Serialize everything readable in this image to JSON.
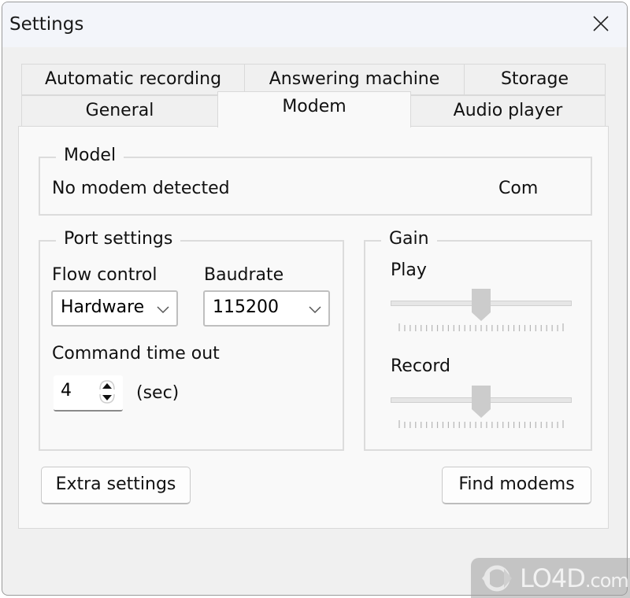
{
  "window": {
    "title": "Settings",
    "close_icon": "close-icon"
  },
  "tabs": {
    "row1": [
      {
        "label": "Automatic recording",
        "active": false
      },
      {
        "label": "Answering machine",
        "active": false
      },
      {
        "label": "Storage",
        "active": false
      }
    ],
    "row2": [
      {
        "label": "General",
        "active": false
      },
      {
        "label": "Modem",
        "active": true
      },
      {
        "label": "Audio player",
        "active": false
      }
    ]
  },
  "model_group": {
    "legend": "Model",
    "status": "No modem detected",
    "port": "Com"
  },
  "port_group": {
    "legend": "Port settings",
    "flow_control": {
      "label": "Flow control",
      "value": "Hardware"
    },
    "baudrate": {
      "label": "Baudrate",
      "value": "115200"
    },
    "command_timeout": {
      "label": "Command time out",
      "value": "4",
      "unit": "(sec)"
    }
  },
  "gain_group": {
    "legend": "Gain",
    "play": {
      "label": "Play",
      "value_fraction": 0.5
    },
    "record": {
      "label": "Record",
      "value_fraction": 0.5
    }
  },
  "buttons": {
    "extra_settings": "Extra settings",
    "find_modems": "Find modems"
  },
  "watermark": {
    "brand": "LO4D",
    "suffix": ".com"
  }
}
